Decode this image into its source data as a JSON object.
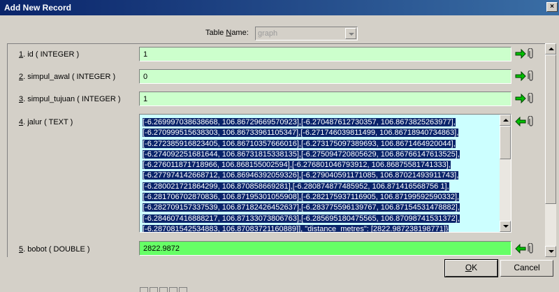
{
  "window": {
    "title": "Add New Record",
    "close_glyph": "×"
  },
  "table_name": {
    "label_prefix": "Table ",
    "label_accel": "N",
    "label_suffix": "ame:",
    "value": "graph"
  },
  "fields": [
    {
      "num": "1",
      "label": ". id ( INTEGER )",
      "value": "1"
    },
    {
      "num": "2",
      "label": ". simpul_awal ( INTEGER )",
      "value": "0"
    },
    {
      "num": "3",
      "label": ". simpul_tujuan ( INTEGER )",
      "value": "1"
    },
    {
      "num": "4",
      "label": ". jalur ( TEXT )"
    },
    {
      "num": "5",
      "label": ". bobot ( DOUBLE )",
      "value": "2822.9872"
    }
  ],
  "jalur_lines": [
    "[-6.269997038638668, 106.86729669570923],[-6.270487612730357, 106.8673825263977],",
    "[-6.270999515638303, 106.86733961105347],[-6.271746039811499, 106.86718940734863],",
    "[-6.272385916823405, 106.86710357666016],[-6.273175097389693, 106.8671464920044],",
    "[-6.274092251681644, 106.86731815338135],[-6.275094720805629, 106.86766147613525],",
    "[-6.276011871718966, 106.868155002594],[-6.276801046793912, 106.86875581741333],",
    "[-6.277974142668712, 106.86946392059326],[-6.279040591171085, 106.87021493911743],",
    "[-6.280021721864299, 106.870858669281],[-6.280874877485952, 106.871416568756 1],",
    "[-6.281706702870836, 106.87195301055908],[-6.282175937116905, 106.87199592590332],",
    "[-6.282709157337539, 106.87182426452637],[-6.283775596139767, 106.87154531478882],",
    "[-6.284607416888217, 106.87133073806763],[-6.285695180475565, 106.87098741531372],",
    "[-6.287081542534883, 106.87083721160889]], \"distance_metres\": [2822.987238198771]}"
  ],
  "buttons": {
    "ok_accel": "O",
    "ok_rest": "K",
    "cancel": "Cancel"
  },
  "colors": {
    "int_field": "#ccffcc",
    "double_field": "#66ff66",
    "text_field": "#ccffff",
    "selection": "#0a246a"
  },
  "icons": {
    "set_value": "arrow-right-icon",
    "get_value": "arrow-left-icon",
    "attach": "paperclip-icon"
  }
}
